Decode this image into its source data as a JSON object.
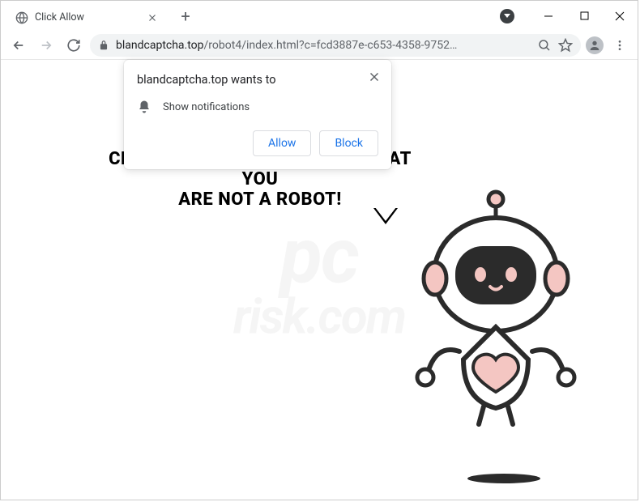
{
  "tab": {
    "title": "Click Allow"
  },
  "url": {
    "host": "blandcaptcha.top",
    "path": "/robot4/index.html?c=fcd3887e-c653-4358-9752…"
  },
  "permission": {
    "title": "blandcaptcha.top wants to",
    "item": "Show notifications",
    "allow": "Allow",
    "block": "Block"
  },
  "page": {
    "line1": "CLICK «ALLOW» TO CONFIRM THAT YOU",
    "line2": "ARE NOT A ROBOT!"
  },
  "watermark": {
    "main": "pc",
    "sub": "risk.com"
  }
}
